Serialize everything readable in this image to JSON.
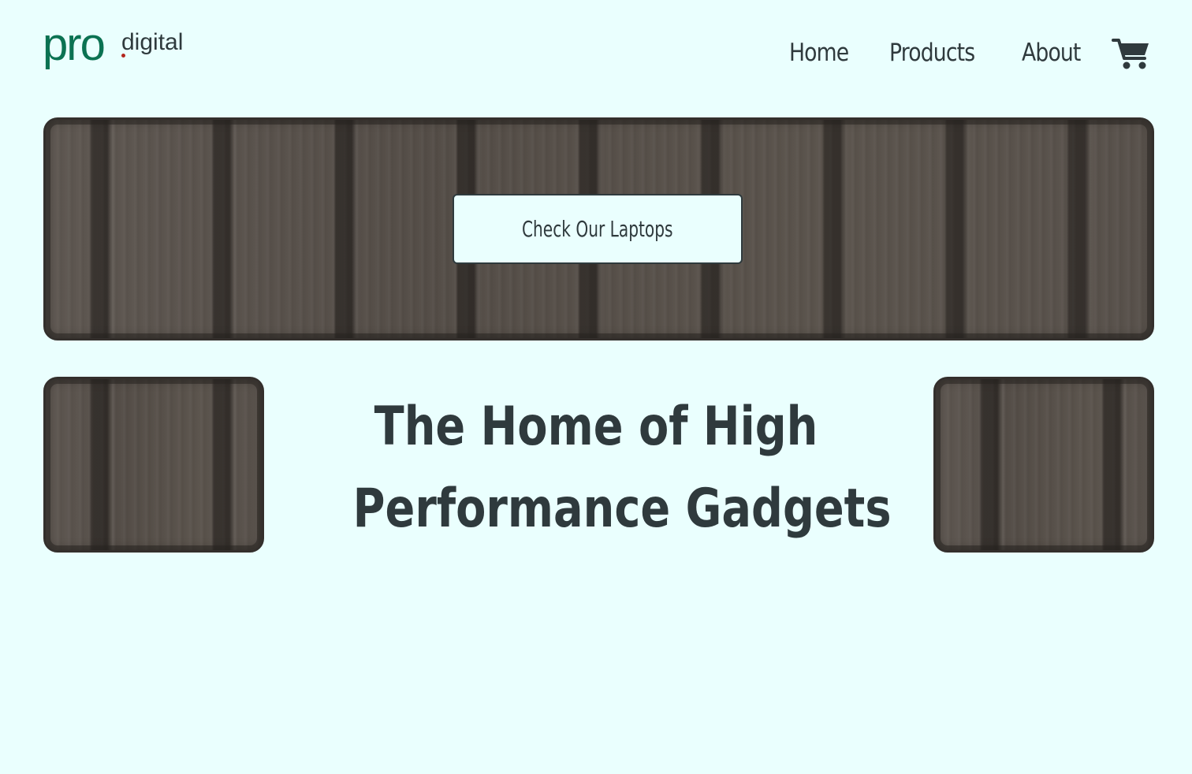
{
  "brand": {
    "name_primary": "pro",
    "name_secondary": "digital",
    "primary_color": "#0b7252",
    "dot_color": "#b3261e"
  },
  "nav": {
    "items": [
      {
        "label": "Home"
      },
      {
        "label": "Products"
      },
      {
        "label": "About"
      }
    ],
    "cart_icon": "shopping-cart-icon"
  },
  "hero": {
    "cta_label": "Check Our Laptops"
  },
  "headline": {
    "line1": "The Home of High",
    "line2": "Performance Gadgets"
  },
  "colors": {
    "background": "#eafffe",
    "text": "#2f3a3d",
    "wood": "#5b544e"
  }
}
